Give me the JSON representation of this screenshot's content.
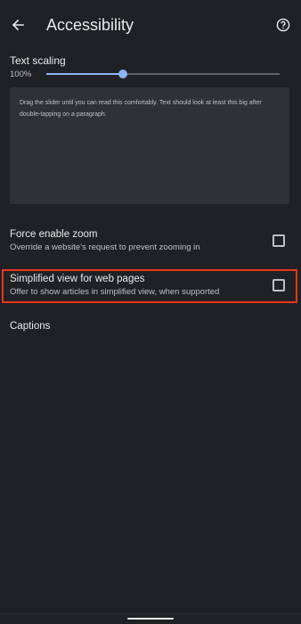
{
  "header": {
    "title": "Accessibility",
    "back_icon": "arrow-left-icon",
    "help_icon": "help-circle-icon"
  },
  "text_scaling": {
    "label": "Text scaling",
    "value": "100%",
    "slider_fraction": 0.33,
    "preview_text": "Drag the slider until you can read this comfortably. Text should look at least this big after double-tapping on a paragraph."
  },
  "settings": [
    {
      "title": "Force enable zoom",
      "subtitle": "Override a website's request to prevent zooming in",
      "checked": false
    },
    {
      "title": "Simplified view for web pages",
      "subtitle": "Offer to show articles in simplified view, when supported",
      "checked": false
    }
  ],
  "captions": {
    "label": "Captions"
  },
  "colors": {
    "background": "#202124",
    "accent": "#8ab4f8",
    "highlight": "#e8371c"
  }
}
